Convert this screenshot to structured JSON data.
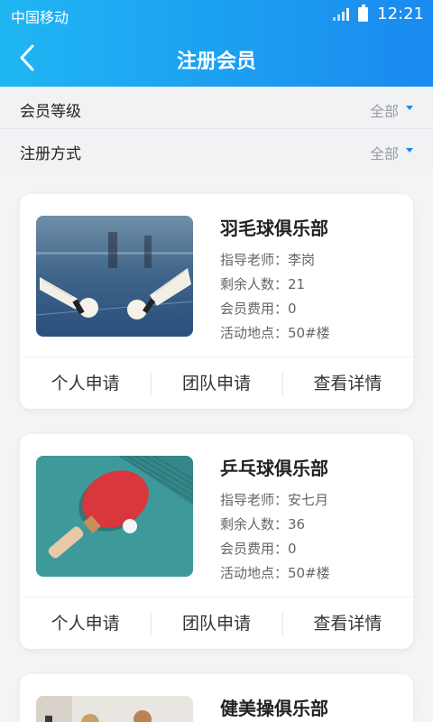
{
  "status": {
    "carrier": "中国移动",
    "time": "12:21"
  },
  "header": {
    "title": "注册会员"
  },
  "filters": [
    {
      "label": "会员等级",
      "value": "全部"
    },
    {
      "label": "注册方式",
      "value": "全部"
    }
  ],
  "labels": {
    "teacher": "指导老师：",
    "remaining": "剩余人数：",
    "fee": "会员费用：",
    "location": "活动地点："
  },
  "actions": {
    "personal": "个人申请",
    "team": "团队申请",
    "detail": "查看详情"
  },
  "clubs": [
    {
      "name": "羽毛球俱乐部",
      "teacher": "李岗",
      "remaining": "21",
      "fee": "0",
      "location": "50#楼",
      "image": "badminton"
    },
    {
      "name": "乒乓球俱乐部",
      "teacher": "安七月",
      "remaining": "36",
      "fee": "0",
      "location": "50#楼",
      "image": "ping-pong"
    },
    {
      "name": "健美操俱乐部",
      "image": "aerobics"
    }
  ],
  "colors": {
    "header_start": "#1fb6f2",
    "header_end": "#1a8af0",
    "caret": "#1a8af0"
  }
}
